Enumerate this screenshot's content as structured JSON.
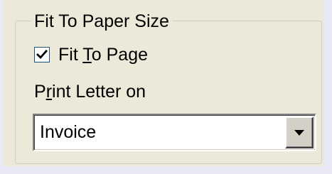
{
  "fit_to_paper_size": {
    "legend": "Fit To Paper Size",
    "fit_to_page": {
      "label_before_mnemonic": "Fit ",
      "label_mnemonic": "T",
      "label_after_mnemonic": "o Page",
      "checked": true,
      "icon": "checkmark-icon"
    },
    "print_letter_on": {
      "label_before_mnemonic": "P",
      "label_mnemonic": "r",
      "label_after_mnemonic": "int Letter on",
      "selected_value": "Invoice",
      "dropdown_icon": "chevron-down-icon"
    }
  },
  "colors": {
    "background": "#e8e8f6",
    "panel": "#ece9d8",
    "checkbox_border": "#1c5180"
  }
}
